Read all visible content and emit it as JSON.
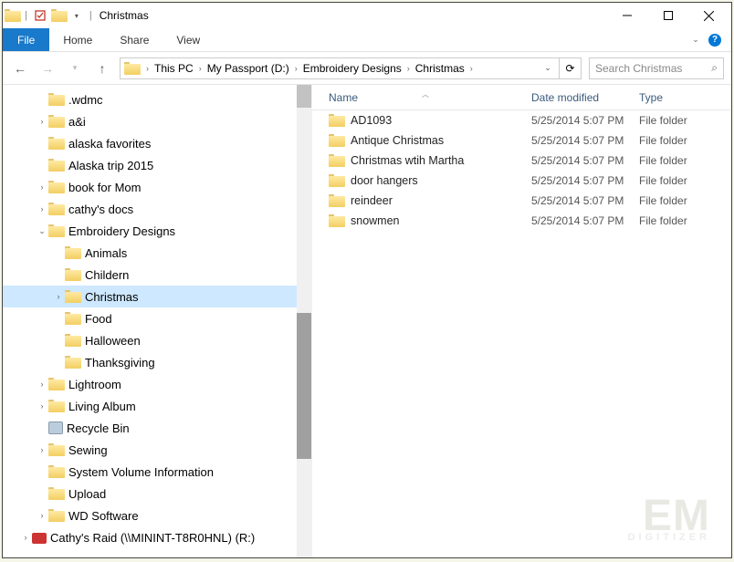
{
  "title": "Christmas",
  "ribbon": {
    "file": "File",
    "tabs": [
      "Home",
      "Share",
      "View"
    ]
  },
  "breadcrumbs": [
    "This PC",
    "My Passport (D:)",
    "Embroidery Designs",
    "Christmas"
  ],
  "search_placeholder": "Search Christmas",
  "columns": {
    "name": "Name",
    "date": "Date modified",
    "type": "Type"
  },
  "tree": [
    {
      "label": ".wdmc",
      "indent": 2,
      "twisty": ""
    },
    {
      "label": "a&i",
      "indent": 2,
      "twisty": ">"
    },
    {
      "label": "alaska favorites",
      "indent": 2,
      "twisty": ""
    },
    {
      "label": "Alaska trip 2015",
      "indent": 2,
      "twisty": ""
    },
    {
      "label": "book for Mom",
      "indent": 2,
      "twisty": ">"
    },
    {
      "label": "cathy's docs",
      "indent": 2,
      "twisty": ">"
    },
    {
      "label": "Embroidery Designs",
      "indent": 2,
      "twisty": "v"
    },
    {
      "label": "Animals",
      "indent": 3,
      "twisty": ""
    },
    {
      "label": "Childern",
      "indent": 3,
      "twisty": ""
    },
    {
      "label": "Christmas",
      "indent": 3,
      "twisty": ">",
      "selected": true
    },
    {
      "label": "Food",
      "indent": 3,
      "twisty": ""
    },
    {
      "label": "Halloween",
      "indent": 3,
      "twisty": ""
    },
    {
      "label": "Thanksgiving",
      "indent": 3,
      "twisty": ""
    },
    {
      "label": "Lightroom",
      "indent": 2,
      "twisty": ">"
    },
    {
      "label": "Living Album",
      "indent": 2,
      "twisty": ">"
    },
    {
      "label": "Recycle Bin",
      "indent": 2,
      "twisty": "",
      "icon": "recycle"
    },
    {
      "label": "Sewing",
      "indent": 2,
      "twisty": ">"
    },
    {
      "label": "System Volume Information",
      "indent": 2,
      "twisty": ""
    },
    {
      "label": "Upload",
      "indent": 2,
      "twisty": ""
    },
    {
      "label": "WD Software",
      "indent": 2,
      "twisty": ">"
    },
    {
      "label": "Cathy's Raid (\\\\MININT-T8R0HNL) (R:)",
      "indent": 1,
      "twisty": ">",
      "icon": "drive"
    }
  ],
  "rows": [
    {
      "name": "AD1093",
      "date": "5/25/2014 5:07 PM",
      "type": "File folder"
    },
    {
      "name": "Antique Christmas",
      "date": "5/25/2014 5:07 PM",
      "type": "File folder"
    },
    {
      "name": "Christmas wtih Martha",
      "date": "5/25/2014 5:07 PM",
      "type": "File folder"
    },
    {
      "name": "door hangers",
      "date": "5/25/2014 5:07 PM",
      "type": "File folder"
    },
    {
      "name": "reindeer",
      "date": "5/25/2014 5:07 PM",
      "type": "File folder"
    },
    {
      "name": "snowmen",
      "date": "5/25/2014 5:07 PM",
      "type": "File folder"
    }
  ],
  "watermark": {
    "main": "EM",
    "sub": "DIGITIZER"
  }
}
